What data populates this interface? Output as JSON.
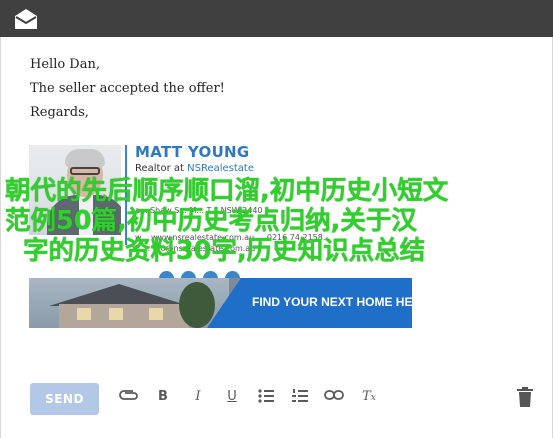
{
  "message": {
    "lines": [
      "Hello Dan,",
      "The seller accepted the offer!",
      "Regards,"
    ]
  },
  "signature": {
    "name": "MATT YOUNG",
    "role_prefix": "Realtor at ",
    "org": "NSRealestate",
    "line1": "a... Shaw S... M... T... NSW 2440",
    "line2": "w... www.nsrealestate.com.au ... 0216 74 2158...",
    "line3": "E ... nfo@nsrealestate.com.au"
  },
  "banner": {
    "cta": "FIND YOUR NEXT HOME HERE"
  },
  "overlay": {
    "line1": "朝代的先后顺序顺口溜,初中历史小短文",
    "line2": "范例50篇,初中历史考点归纳,关于汉",
    "line3": "字的历史资料30字,历史知识点总结"
  },
  "toolbar": {
    "send_label": "SEND",
    "bold_label": "B",
    "italic_label": "I",
    "underline_label": "U",
    "clear_label": "T"
  },
  "colors": {
    "accent": "#2e78c0",
    "send_button": "#b3c7e6",
    "topbar": "#404040",
    "overlay_text": "#2ed12a"
  },
  "icons": [
    "mail-icon",
    "attach-icon",
    "bold-icon",
    "italic-icon",
    "underline-icon",
    "bulleted-list-icon",
    "numbered-list-icon",
    "link-icon",
    "clear-format-icon",
    "trash-icon"
  ]
}
